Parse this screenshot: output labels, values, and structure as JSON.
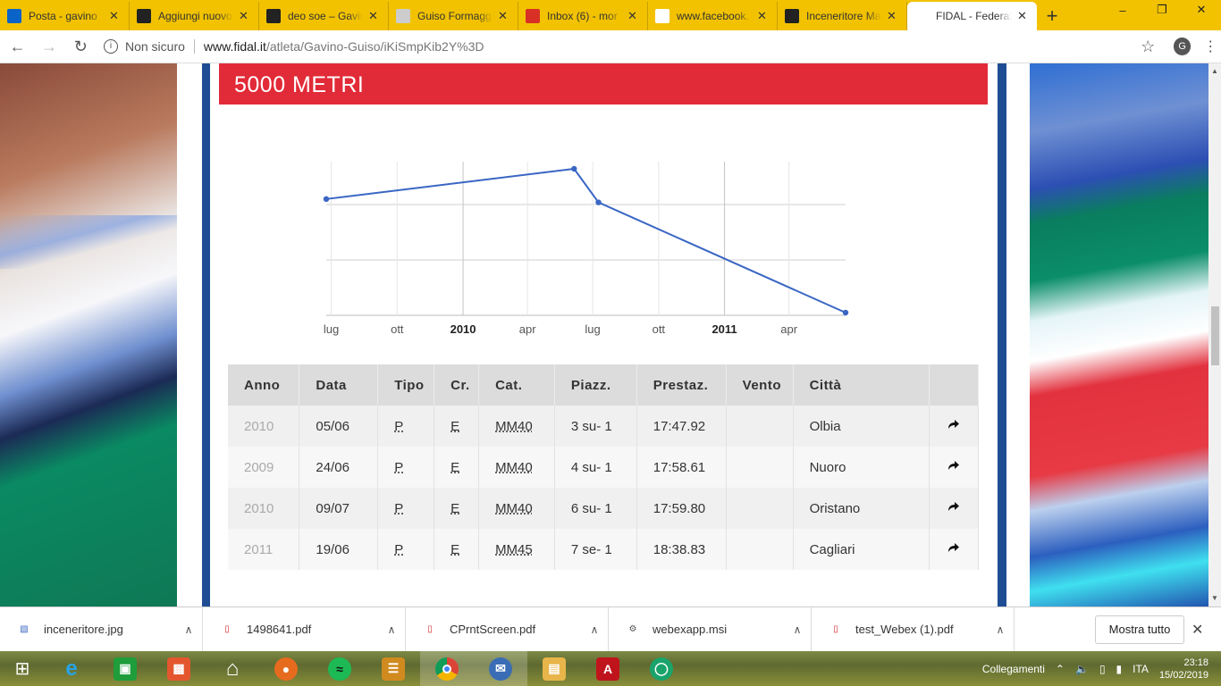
{
  "browser": {
    "tabs": [
      {
        "title": "Posta - gavino",
        "icon": "outlook-icon",
        "color": "#0a64c8"
      },
      {
        "title": "Aggiungi nuovo",
        "icon": "wordpress-icon",
        "color": "#222222"
      },
      {
        "title": "deo soe – Gavin",
        "icon": "wordpress-icon",
        "color": "#222222"
      },
      {
        "title": "Guiso Formagg",
        "icon": "cheese-icon",
        "color": "#cccccc"
      },
      {
        "title": "Inbox (6) - mor",
        "icon": "gmail-icon",
        "color": "#d93025"
      },
      {
        "title": "www.facebook.",
        "icon": "page-icon",
        "color": "#ffffff"
      },
      {
        "title": "Inceneritore Ma",
        "icon": "wordpress-icon",
        "color": "#222222"
      },
      {
        "title": "FIDAL - Federaz",
        "icon": "fidal-icon",
        "color": "#ffffff"
      }
    ],
    "active_tab": 7,
    "address": {
      "security": "Non sicuro",
      "host": "www.fidal.it",
      "path": "/atleta/Gavino-Guiso/iKiSmpKib2Y%3D"
    },
    "profile_initial": "G"
  },
  "page": {
    "section_title": "5000 METRI",
    "table": {
      "headers": [
        "Anno",
        "Data",
        "Tipo",
        "Cr.",
        "Cat.",
        "Piazz.",
        "Prestaz.",
        "Vento",
        "Città",
        ""
      ],
      "rows": [
        {
          "anno": "2010",
          "data": "05/06",
          "tipo": "P",
          "cr": "E",
          "cat": "MM40",
          "piazz": "3 su- 1",
          "prestaz": "17:47.92",
          "vento": "",
          "citta": "Olbia"
        },
        {
          "anno": "2009",
          "data": "24/06",
          "tipo": "P",
          "cr": "E",
          "cat": "MM40",
          "piazz": "4 su- 1",
          "prestaz": "17:58.61",
          "vento": "",
          "citta": "Nuoro"
        },
        {
          "anno": "2010",
          "data": "09/07",
          "tipo": "P",
          "cr": "E",
          "cat": "MM40",
          "piazz": "6 su- 1",
          "prestaz": "17:59.80",
          "vento": "",
          "citta": "Oristano"
        },
        {
          "anno": "2011",
          "data": "19/06",
          "tipo": "P",
          "cr": "E",
          "cat": "MM45",
          "piazz": "7 se- 1",
          "prestaz": "18:38.83",
          "vento": "",
          "citta": "Cagliari"
        }
      ]
    }
  },
  "chart_data": {
    "type": "line",
    "title": "",
    "xlabel": "",
    "ylabel": "",
    "x_tick_labels": [
      "lug",
      "ott",
      "2010",
      "apr",
      "lug",
      "ott",
      "2011",
      "apr"
    ],
    "x_ticks": [
      "2009-07-01",
      "2009-10-01",
      "2010-01-01",
      "2010-04-01",
      "2010-07-01",
      "2010-10-01",
      "2011-01-01",
      "2011-04-01"
    ],
    "xlim": [
      "2009-06-24",
      "2011-06-19"
    ],
    "y_inverted": true,
    "ylim_seconds": [
      1067.92,
      1118.83
    ],
    "grid": true,
    "series": [
      {
        "points": [
          {
            "x": "2009-06-24",
            "y": "17:58.61",
            "y_seconds": 1078.61
          },
          {
            "x": "2010-06-05",
            "y": "17:47.92",
            "y_seconds": 1067.92
          },
          {
            "x": "2010-07-09",
            "y": "17:59.80",
            "y_seconds": 1079.8
          },
          {
            "x": "2011-06-19",
            "y": "18:38.83",
            "y_seconds": 1118.83
          }
        ],
        "color": "#3a66c4"
      }
    ]
  },
  "downloads": {
    "items": [
      {
        "name": "inceneritore.jpg",
        "icon": "image-file-icon"
      },
      {
        "name": "1498641.pdf",
        "icon": "pdf-file-icon"
      },
      {
        "name": "CPrntScreen.pdf",
        "icon": "pdf-file-icon"
      },
      {
        "name": "webexapp.msi",
        "icon": "installer-file-icon"
      },
      {
        "name": "test_Webex (1).pdf",
        "icon": "pdf-file-icon"
      }
    ],
    "show_all": "Mostra tutto"
  },
  "taskbar": {
    "tray_label": "Collegamenti",
    "language": "ITA",
    "time": "23:18",
    "date": "15/02/2019"
  },
  "colors": {
    "accent_red": "#e22b38",
    "frame_blue": "#1e4d94",
    "line_blue": "#3a66c4"
  }
}
